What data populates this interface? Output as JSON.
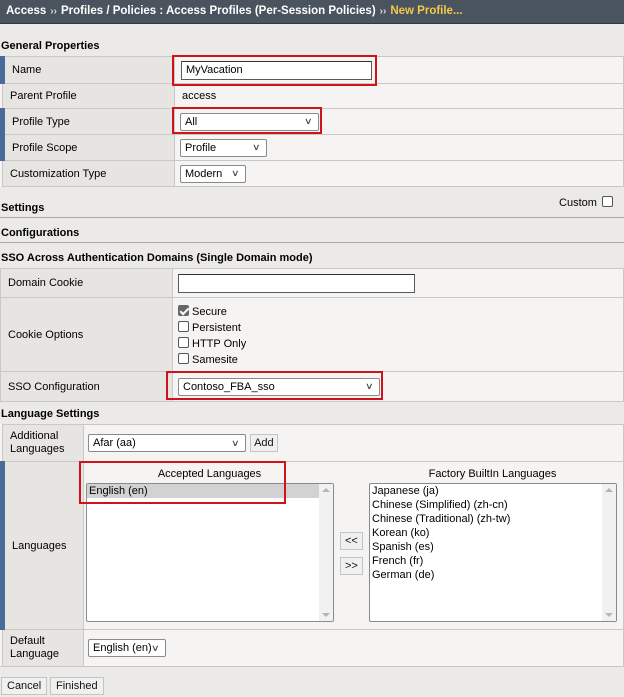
{
  "breadcrumb": {
    "items": [
      "Access",
      "Profiles / Policies : Access Profiles (Per-Session Policies)"
    ],
    "current": "New Profile...",
    "separator": "››"
  },
  "general": {
    "title": "General Properties",
    "name_label": "Name",
    "name_value": "MyVacation",
    "parent_label": "Parent Profile",
    "parent_value": "access",
    "type_label": "Profile Type",
    "type_value": "All",
    "scope_label": "Profile Scope",
    "scope_value": "Profile",
    "customization_label": "Customization Type",
    "customization_value": "Modern"
  },
  "settings": {
    "title": "Settings",
    "custom_label": "Custom",
    "custom_checked": false
  },
  "configurations": {
    "title": "Configurations"
  },
  "sso": {
    "title": "SSO Across Authentication Domains (Single Domain mode)",
    "domain_cookie_label": "Domain Cookie",
    "domain_cookie_value": "",
    "cookie_options_label": "Cookie Options",
    "cookie_options": [
      {
        "label": "Secure",
        "checked": true
      },
      {
        "label": "Persistent",
        "checked": false
      },
      {
        "label": "HTTP Only",
        "checked": false
      },
      {
        "label": "Samesite",
        "checked": false
      }
    ],
    "sso_config_label": "SSO Configuration",
    "sso_config_value": "Contoso_FBA_sso"
  },
  "language": {
    "title": "Language Settings",
    "additional_label": "Additional Languages",
    "additional_value": "Afar (aa)",
    "add_button": "Add",
    "languages_label": "Languages",
    "accepted_title": "Accepted Languages",
    "accepted": [
      "English (en)"
    ],
    "factory_title": "Factory BuiltIn Languages",
    "factory": [
      "Japanese (ja)",
      "Chinese (Simplified) (zh-cn)",
      "Chinese (Traditional) (zh-tw)",
      "Korean (ko)",
      "Spanish (es)",
      "French (fr)",
      "German (de)"
    ],
    "move_left": "<<",
    "move_right": ">>",
    "default_label": "Default Language",
    "default_value": "English (en)"
  },
  "footer": {
    "cancel": "Cancel",
    "finished": "Finished"
  },
  "colors": {
    "highlight_box": "#d0121b",
    "breadcrumb_current": "#f2c94c",
    "required_marker": "#4a6a9a"
  }
}
